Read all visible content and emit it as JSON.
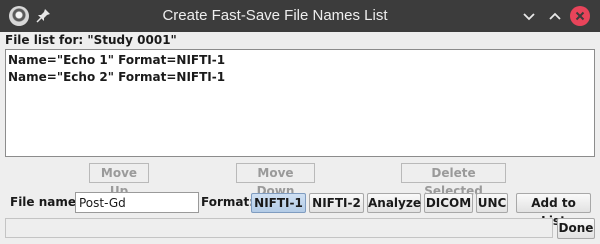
{
  "window": {
    "title": "Create Fast-Save File Names List",
    "icons": {
      "app": "app-logo-icon",
      "pin": "pin-icon",
      "minimize": "chevron-down-icon",
      "maximize": "chevron-up-icon",
      "close": "close-icon"
    },
    "colors": {
      "titlebar": "#3c3c3c",
      "close": "#e8445a"
    }
  },
  "file_list": {
    "label": "File list for: \"Study 0001\"",
    "items": [
      {
        "text": "Name=\"Echo 1\" Format=NIFTI-1"
      },
      {
        "text": "Name=\"Echo 2\" Format=NIFTI-1"
      }
    ]
  },
  "list_actions": {
    "move_up": "Move Up",
    "move_down": "Move Down",
    "delete_selected": "Delete Selected"
  },
  "file_name": {
    "label": "File name:",
    "value": "Post-Gd"
  },
  "format": {
    "label": "Format:",
    "options": [
      "NIFTI-1",
      "NIFTI-2",
      "Analyze",
      "DICOM",
      "UNC"
    ],
    "selected": "NIFTI-1"
  },
  "add_to_list": "Add to List",
  "status": {
    "text": ""
  },
  "done": "Done"
}
